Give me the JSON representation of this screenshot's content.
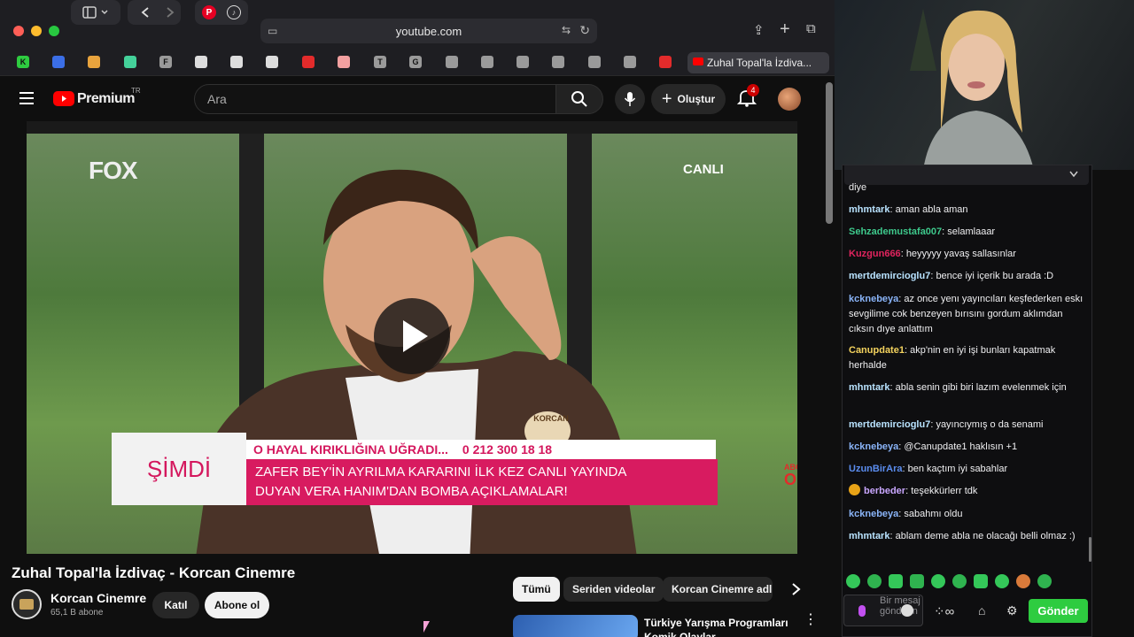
{
  "browser": {
    "address": "youtube.com",
    "active_tab_title": "Zuhal Topal'la İzdiva...",
    "bookmark_letters": [
      "F",
      "T",
      "G"
    ]
  },
  "youtube": {
    "logo_text": "Premium",
    "logo_region": "TR",
    "search_placeholder": "Ara",
    "create_label": "Oluştur",
    "notification_count": "4"
  },
  "video": {
    "channel_logo": "FOX",
    "live_badge": "CANLI",
    "segment_label": "ŞİMDİ",
    "ticker_line": "O HAYAL KIRIKLIĞINA UĞRADI...",
    "ticker_phone": "0 212 300 18 18",
    "headline_1": "ZAFER BEY'İN AYRILMA KARARINI İLK KEZ CANLI YAYINDA",
    "headline_2": "DUYAN VERA HANIM'DAN BOMBA AÇIKLAMALAR!",
    "name_tag": "KORCAN",
    "corner_1": "ABONE",
    "corner_2": "OL"
  },
  "info": {
    "title": "Zuhal Topal'la İzdivaç - Korcan Cinemre",
    "channel_name": "Korcan Cinemre",
    "subscribers": "65,1 B abone",
    "join_label": "Katıl",
    "subscribe_label": "Abone ol"
  },
  "chips": [
    "Tümü",
    "Seriden videolar",
    "Korcan Cinemre adlı y"
  ],
  "recommended": {
    "title_1": "Türkiye Yarışma Programları",
    "title_2": "Komik Olaylar"
  },
  "chat": {
    "messages": [
      {
        "user": "",
        "color": "#efeff1",
        "text": "diye"
      },
      {
        "user": "mhmtark",
        "color": "#b9e3ff",
        "text": "aman abla aman"
      },
      {
        "user": "Sehzademustafa007",
        "color": "#3ec98c",
        "text": "selamlaaar"
      },
      {
        "user": "Kuzgun666",
        "color": "#e0245e",
        "text": "heyyyyy yavaş sallasınlar"
      },
      {
        "user": "mertdemircioglu7",
        "color": "#b9e3ff",
        "text": "bence iyi içerik bu arada :D"
      },
      {
        "user": "kcknebeya",
        "color": "#8ab4f8",
        "text": "az once yenı yayıncıları keşfederken eskı sevgilime cok benzeyen bırısını gordum aklımdan cıksın dıye anlattım"
      },
      {
        "user": "Canupdate1",
        "color": "#f4d35e",
        "text": "akp'nin en iyi işi bunları kapatmak herhalde"
      },
      {
        "user": "mhmtark",
        "color": "#b9e3ff",
        "text": "abla senin gibi biri lazım evelenmek için"
      },
      {
        "user": "mertdemircioglu7",
        "color": "#b9e3ff",
        "text": "yayıncıymış o da senami"
      },
      {
        "user": "kcknebeya",
        "color": "#8ab4f8",
        "text": "@Canupdate1 haklısın +1"
      },
      {
        "user": "UzunBirAra",
        "color": "#5b8def",
        "text": "ben kaçtım iyi sabahlar"
      },
      {
        "user": "berbeder",
        "color": "#c9a7ff",
        "text": "teşekkürlerr tdk"
      },
      {
        "user": "kcknebeya",
        "color": "#8ab4f8",
        "text": "sabahmı oldu"
      },
      {
        "user": "mhmtark",
        "color": "#b9e3ff",
        "text": "ablam deme abla ne olacağı belli olmaz :)"
      }
    ],
    "input_placeholder": "Bir mesaj gönderin",
    "send_label": "Gönder"
  }
}
